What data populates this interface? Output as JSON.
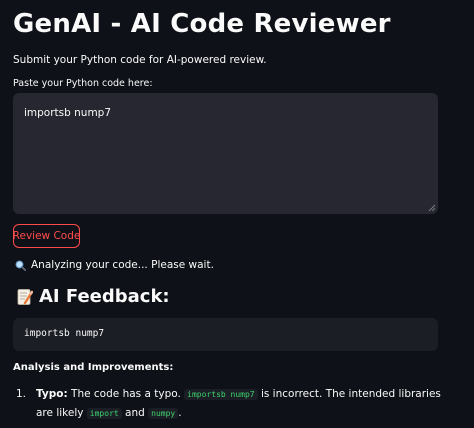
{
  "header": {
    "title": "GenAI - AI Code Reviewer",
    "subtitle": "Submit your Python code for AI-powered review."
  },
  "code_input": {
    "label": "Paste your Python code here:",
    "value": "importsb nump7"
  },
  "review_button": {
    "label": "Review Code",
    "color": "#ff4b4b"
  },
  "status": {
    "icon": "magnifier-icon",
    "text": "Analyzing your code... Please wait."
  },
  "feedback": {
    "icon": "memo-icon",
    "heading": "AI Feedback:",
    "code": "importsb nump7",
    "analysis_heading": "Analysis and Improvements:",
    "items": [
      {
        "number": "1.",
        "title": "Typo:",
        "text1": "The code has a typo.",
        "code1": "importsb nump7",
        "text2": "is incorrect. The intended libraries are likely",
        "code2": "import",
        "text3": "and",
        "code3": "numpy",
        "text4": "."
      }
    ]
  },
  "colors": {
    "background": "#0e1117",
    "input_background": "#262730",
    "code_background": "#1c1e26",
    "inline_code": "#3dd56d"
  }
}
